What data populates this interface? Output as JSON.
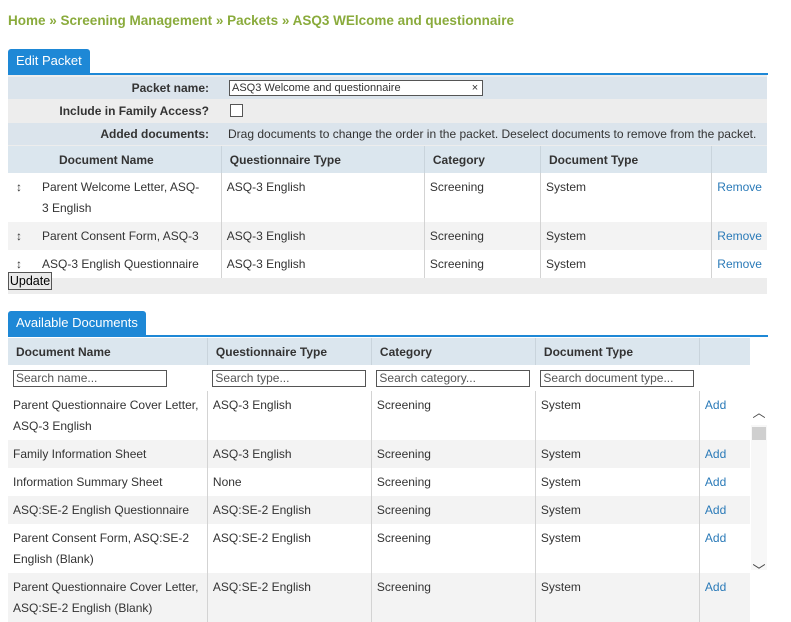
{
  "breadcrumb": {
    "home": "Home",
    "sep": " » ",
    "screening": "Screening Management",
    "packets": "Packets",
    "current": "ASQ3 WElcome and questionnaire"
  },
  "edit_packet": {
    "tab_label": "Edit Packet",
    "packet_name_label": "Packet name:",
    "packet_name_value": "ASQ3 Welcome and questionnaire",
    "clear_icon": "×",
    "family_access_label": "Include in Family Access?",
    "added_documents_label": "Added documents:",
    "added_documents_hint": "Drag documents to change the order in the packet. Deselect documents to remove from the packet.",
    "columns": [
      "Document Name",
      "Questionnaire Type",
      "Category",
      "Document Type"
    ],
    "drag_icon": "↕",
    "rows": [
      {
        "name": "Parent Welcome Letter, ASQ-3 English",
        "qtype": "ASQ-3 English",
        "category": "Screening",
        "dtype": "System",
        "action": "Remove"
      },
      {
        "name": "Parent Consent Form, ASQ-3",
        "qtype": "ASQ-3 English",
        "category": "Screening",
        "dtype": "System",
        "action": "Remove"
      },
      {
        "name": "ASQ-3 English Questionnaire",
        "qtype": "ASQ-3 English",
        "category": "Screening",
        "dtype": "System",
        "action": "Remove"
      }
    ],
    "update_label": "Update"
  },
  "available": {
    "tab_label": "Available Documents",
    "columns": [
      "Document Name",
      "Questionnaire Type",
      "Category",
      "Document Type"
    ],
    "filters": {
      "name_placeholder": "Search name...",
      "type_placeholder": "Search type...",
      "category_placeholder": "Search category...",
      "doctype_placeholder": "Search document type..."
    },
    "rows": [
      {
        "name": "Parent Questionnaire Cover Letter, ASQ-3 English",
        "qtype": "ASQ-3 English",
        "category": "Screening",
        "dtype": "System",
        "action": "Add"
      },
      {
        "name": "Family Information Sheet",
        "qtype": "ASQ-3 English",
        "category": "Screening",
        "dtype": "System",
        "action": "Add"
      },
      {
        "name": "Information Summary Sheet",
        "qtype": "None",
        "category": "Screening",
        "dtype": "System",
        "action": "Add"
      },
      {
        "name": "ASQ:SE-2 English Questionnaire",
        "qtype": "ASQ:SE-2 English",
        "category": "Screening",
        "dtype": "System",
        "action": "Add"
      },
      {
        "name": "Parent Consent Form, ASQ:SE-2 English (Blank)",
        "qtype": "ASQ:SE-2 English",
        "category": "Screening",
        "dtype": "System",
        "action": "Add"
      },
      {
        "name": "Parent Questionnaire Cover Letter, ASQ:SE-2 English (Blank)",
        "qtype": "ASQ:SE-2 English",
        "category": "Screening",
        "dtype": "System",
        "action": "Add"
      }
    ],
    "scroll_up_icon": "︿",
    "scroll_down_icon": "﹀"
  },
  "colors": {
    "accent": "#1e88d6",
    "breadcrumb": "#8aab3c",
    "link": "#2a7ab8",
    "header_bg": "#dbe6ee"
  }
}
